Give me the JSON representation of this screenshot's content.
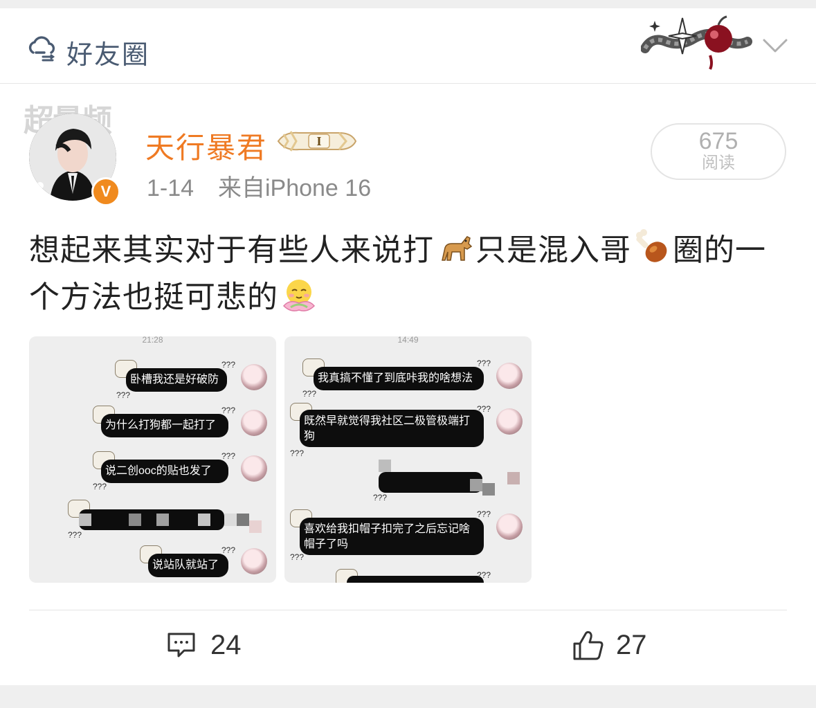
{
  "header": {
    "title": "好友圈",
    "icon": "cloud-people-icon"
  },
  "post": {
    "watermark": "超量频",
    "author": "天行暴君",
    "verified_badge": "V",
    "level_badge": "I",
    "date": "1-14",
    "source": "来自iPhone 16",
    "reads_count": "675",
    "reads_label": "阅读",
    "text_part1": "想起来其实对于有些人来说打",
    "text_part2": "只是混入哥",
    "text_part3": "圈的一个方法也挺可悲的",
    "emojis": [
      "dog-emoji",
      "chicken-leg-emoji",
      "lotus-face-emoji"
    ]
  },
  "images": [
    {
      "time": "21:28",
      "messages": [
        "卧槽我还是好破防",
        "为什么打狗都一起打了",
        "说二创ooc的贴也发了",
        "说站队就站了"
      ]
    },
    {
      "time": "14:49",
      "messages": [
        "我真搞不懂了到底咔我的啥想法",
        "既然早就觉得我社区二极管极端打狗",
        "喜欢给我扣帽子扣完了之后忘记啥帽子了吗"
      ]
    }
  ],
  "actions": {
    "comments": "24",
    "likes": "27"
  },
  "colors": {
    "accent": "#ef7a23",
    "header_text": "#4a5b72",
    "badge": "#f08a1e"
  }
}
